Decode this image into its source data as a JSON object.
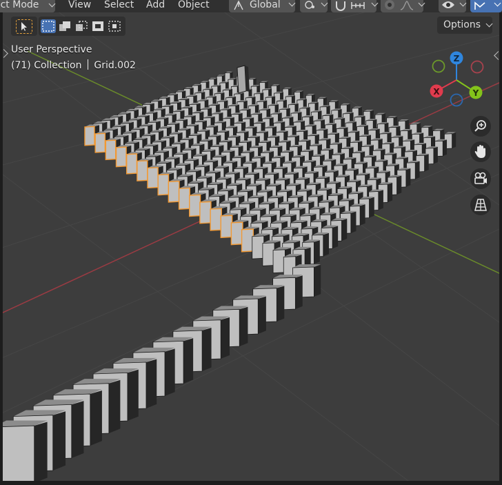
{
  "header": {
    "mode_label": "ect Mode",
    "menus": [
      "View",
      "Select",
      "Add",
      "Object"
    ],
    "transform_orientation": "Global"
  },
  "options_label": "Options",
  "overlay": {
    "perspective_label": "User Perspective",
    "collection_prefix": "(71) Collection",
    "active_object": "Grid.002"
  },
  "gizmo": {
    "z_label": "Z",
    "x_label": "X",
    "y_label": "Y",
    "colors": {
      "x": "#e03b4d",
      "y": "#84c31b",
      "z": "#2f86de"
    }
  },
  "icons": {
    "zoom": "zoom-icon",
    "pan": "hand-icon",
    "camera": "camera-icon",
    "ortho": "grid-perspective-icon"
  },
  "scene": {
    "selection_color": "#f29933",
    "domino_light": "#bfbfbf",
    "domino_dark": "#262626"
  }
}
